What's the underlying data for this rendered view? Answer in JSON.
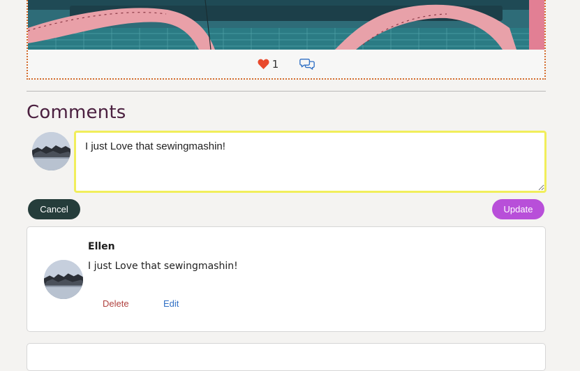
{
  "post": {
    "like_count": "1",
    "like_color": "#e8492c",
    "comment_icon_color": "#2f6fc4"
  },
  "comments_section": {
    "title": "Comments",
    "composer": {
      "text_value": "I just Love that sewingmashin!",
      "cancel_label": "Cancel",
      "update_label": "Update"
    },
    "items": [
      {
        "author": "Ellen",
        "text": "I just Love that sewingmashin!",
        "delete_label": "Delete",
        "edit_label": "Edit"
      }
    ]
  },
  "colors": {
    "title": "#4a1f3f",
    "cancel_bg": "#253d3b",
    "update_bg": "#b84fd9",
    "focus_border": "#f1ee5b",
    "delete": "#b0413e",
    "edit": "#2f6fc4",
    "post_border": "#d36b2c"
  },
  "icons": {
    "like": "heart-icon",
    "comment": "speech-bubbles-icon"
  }
}
